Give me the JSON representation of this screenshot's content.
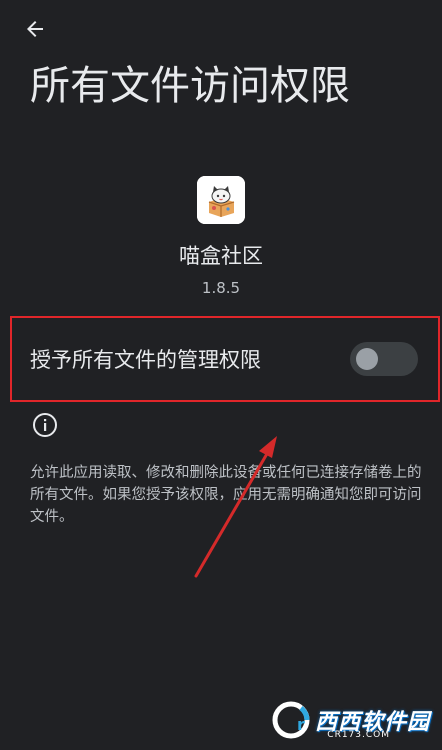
{
  "header": {
    "back_icon": "arrow-left-icon",
    "title": "所有文件访问权限"
  },
  "app": {
    "name": "喵盒社区",
    "version": "1.8.5",
    "icon": "cat-box-app-icon"
  },
  "permission": {
    "label": "授予所有文件的管理权限",
    "enabled": false
  },
  "info": {
    "icon": "info-icon",
    "description": "允许此应用读取、修改和删除此设备或任何已连接存储卷上的所有文件。如果您授予该权限，应用无需明确通知您即可访问文件。"
  },
  "watermark": {
    "brand": "西西软件园",
    "site": "CR173.COM"
  },
  "colors": {
    "background": "#202124",
    "text_primary": "#e8eaed",
    "text_secondary": "#bdc1c6",
    "highlight_border": "#e0262a",
    "toggle_track": "#3c4043",
    "toggle_thumb": "#9aa0a6"
  }
}
